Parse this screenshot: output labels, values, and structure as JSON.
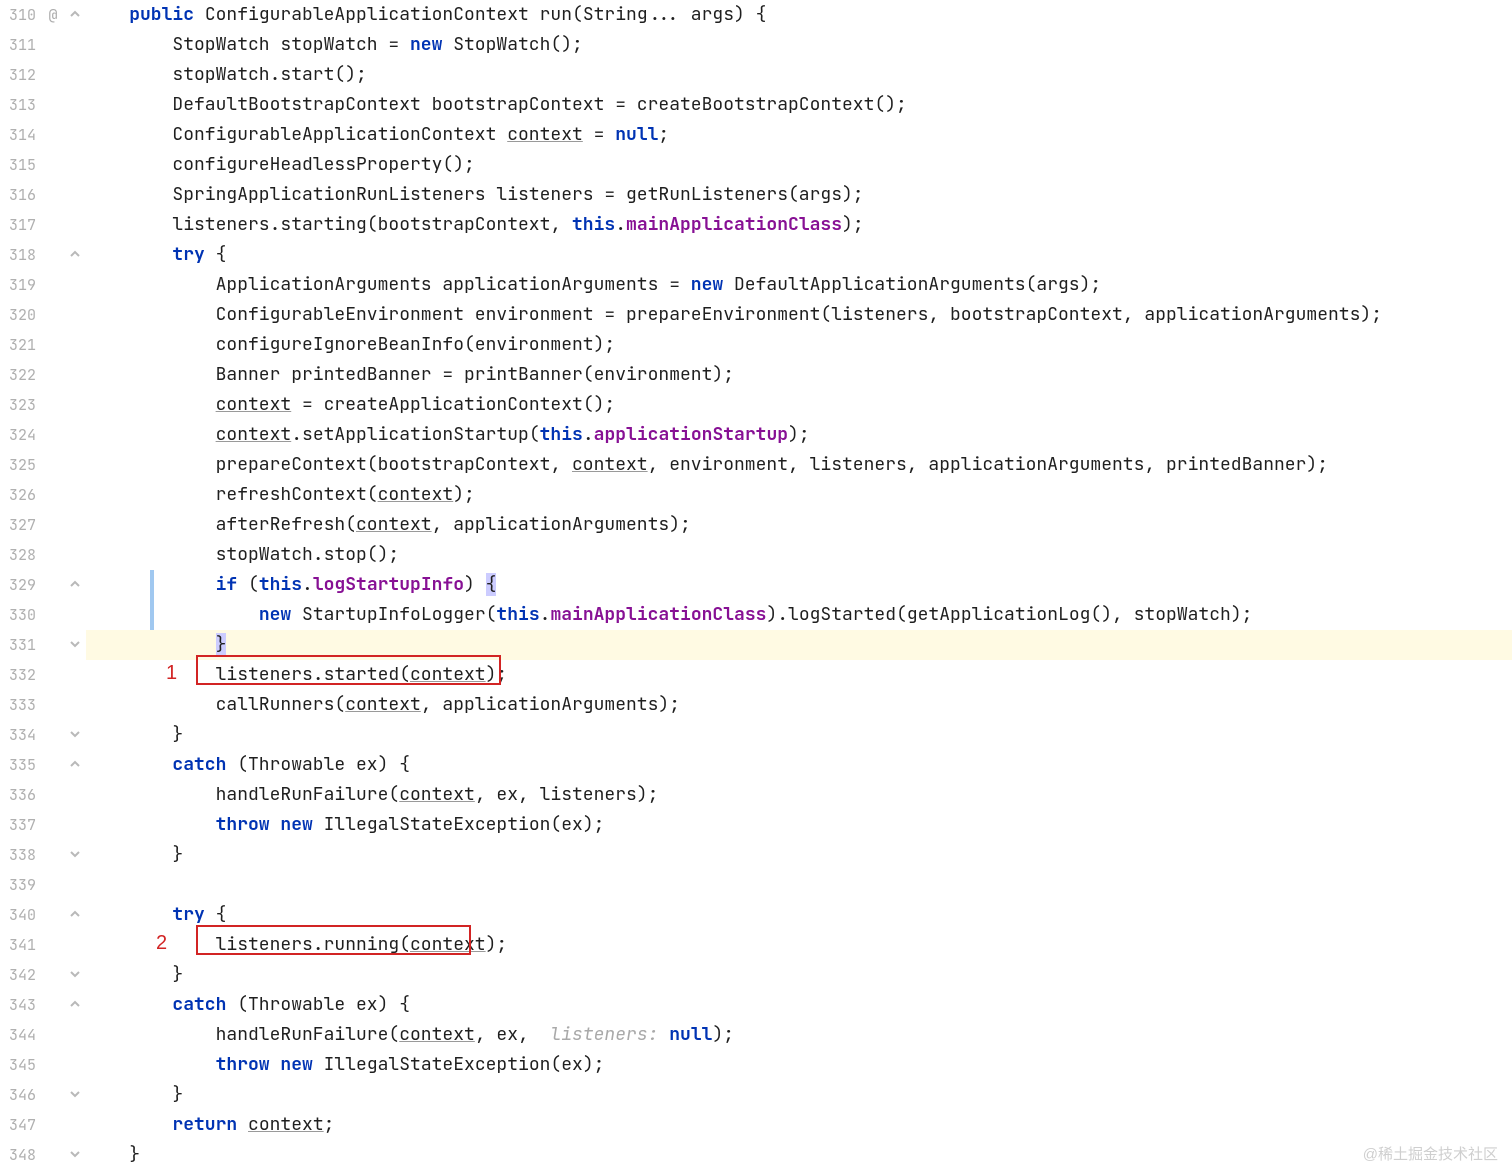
{
  "watermark": "@稀土掘金技术社区",
  "first_line": 310,
  "modified_mark": "@",
  "annotations": {
    "label1": "1",
    "label2": "2"
  },
  "tokens": {
    "public": "public",
    "new": "new",
    "null": "null",
    "try": "try",
    "catch": "catch",
    "throw": "throw",
    "if": "if",
    "return": "return",
    "this": "this"
  },
  "fields": {
    "mainApplicationClass": "mainApplicationClass",
    "applicationStartup": "applicationStartup",
    "logStartupInfo": "logStartupInfo"
  },
  "lines": {
    "l310": {
      "pre": "    ",
      "a": "public",
      "b": " ConfigurableApplicationContext run(String... args) {"
    },
    "l311": {
      "pre": "        StopWatch stopWatch = ",
      "a": "new",
      "b": " StopWatch();"
    },
    "l312": "        stopWatch.start();",
    "l313": "        DefaultBootstrapContext bootstrapContext = createBootstrapContext();",
    "l314": {
      "pre": "        ConfigurableApplicationContext ",
      "u": "context",
      "mid": " = ",
      "kw": "null",
      "post": ";"
    },
    "l315": "        configureHeadlessProperty();",
    "l316": "        SpringApplicationRunListeners listeners = getRunListeners(args);",
    "l317": {
      "pre": "        listeners.starting(bootstrapContext, ",
      "a": "this",
      "dot": ".",
      "f": "mainApplicationClass",
      "post": ");"
    },
    "l318": {
      "pre": "        ",
      "a": "try",
      "b": " {"
    },
    "l319": {
      "pre": "            ApplicationArguments applicationArguments = ",
      "a": "new",
      "b": " DefaultApplicationArguments(args);"
    },
    "l320": "            ConfigurableEnvironment environment = prepareEnvironment(listeners, bootstrapContext, applicationArguments);",
    "l321": "            configureIgnoreBeanInfo(environment);",
    "l322": "            Banner printedBanner = printBanner(environment);",
    "l323": {
      "pre": "            ",
      "u": "context",
      "post": " = createApplicationContext();"
    },
    "l324": {
      "pre": "            ",
      "u": "context",
      "mid": ".setApplicationStartup(",
      "a": "this",
      "dot": ".",
      "f": "applicationStartup",
      "post": ");"
    },
    "l325": {
      "pre": "            prepareContext(bootstrapContext, ",
      "u": "context",
      "post": ", environment, listeners, applicationArguments, printedBanner);"
    },
    "l326": {
      "pre": "            refreshContext(",
      "u": "context",
      "post": ");"
    },
    "l327": {
      "pre": "            afterRefresh(",
      "u": "context",
      "post": ", applicationArguments);"
    },
    "l328": "            stopWatch.stop();",
    "l329": {
      "pre": "            ",
      "a": "if",
      "b": " (",
      "c": "this",
      "dot": ".",
      "f": "logStartupInfo",
      "post": ") ",
      "brace": "{"
    },
    "l330": {
      "pre": "                ",
      "a": "new",
      "b": " StartupInfoLogger(",
      "c": "this",
      "dot": ".",
      "f": "mainApplicationClass",
      "post": ").logStarted(getApplicationLog(), stopWatch);"
    },
    "l331": {
      "pre": "            ",
      "brace": "}"
    },
    "l332": {
      "pre": "            listeners.started(",
      "u": "context",
      "post": ");"
    },
    "l333": {
      "pre": "            callRunners(",
      "u": "context",
      "post": ", applicationArguments);"
    },
    "l334": "        }",
    "l335": {
      "pre": "        ",
      "a": "catch",
      "b": " (Throwable ex) {"
    },
    "l336": {
      "pre": "            handleRunFailure(",
      "u": "context",
      "post": ", ex, listeners);"
    },
    "l337": {
      "pre": "            ",
      "a": "throw",
      "b": " ",
      "c": "new",
      "d": " IllegalStateException(ex);"
    },
    "l338": "        }",
    "l339": "",
    "l340": {
      "pre": "        ",
      "a": "try",
      "b": " {"
    },
    "l341": {
      "pre": "            listeners.running(",
      "u": "context",
      "post": ");"
    },
    "l342": "        }",
    "l343": {
      "pre": "        ",
      "a": "catch",
      "b": " (Throwable ex) {"
    },
    "l344": {
      "pre": "            handleRunFailure(",
      "u": "context",
      "mid": ", ex,  ",
      "hint": "listeners: ",
      "kw": "null",
      "post": ");"
    },
    "l345": {
      "pre": "            ",
      "a": "throw",
      "b": " ",
      "c": "new",
      "d": " IllegalStateException(ex);"
    },
    "l346": "        }",
    "l347": {
      "pre": "        ",
      "a": "return",
      "b": " ",
      "u": "context",
      "post": ";"
    },
    "l348": "    }"
  }
}
